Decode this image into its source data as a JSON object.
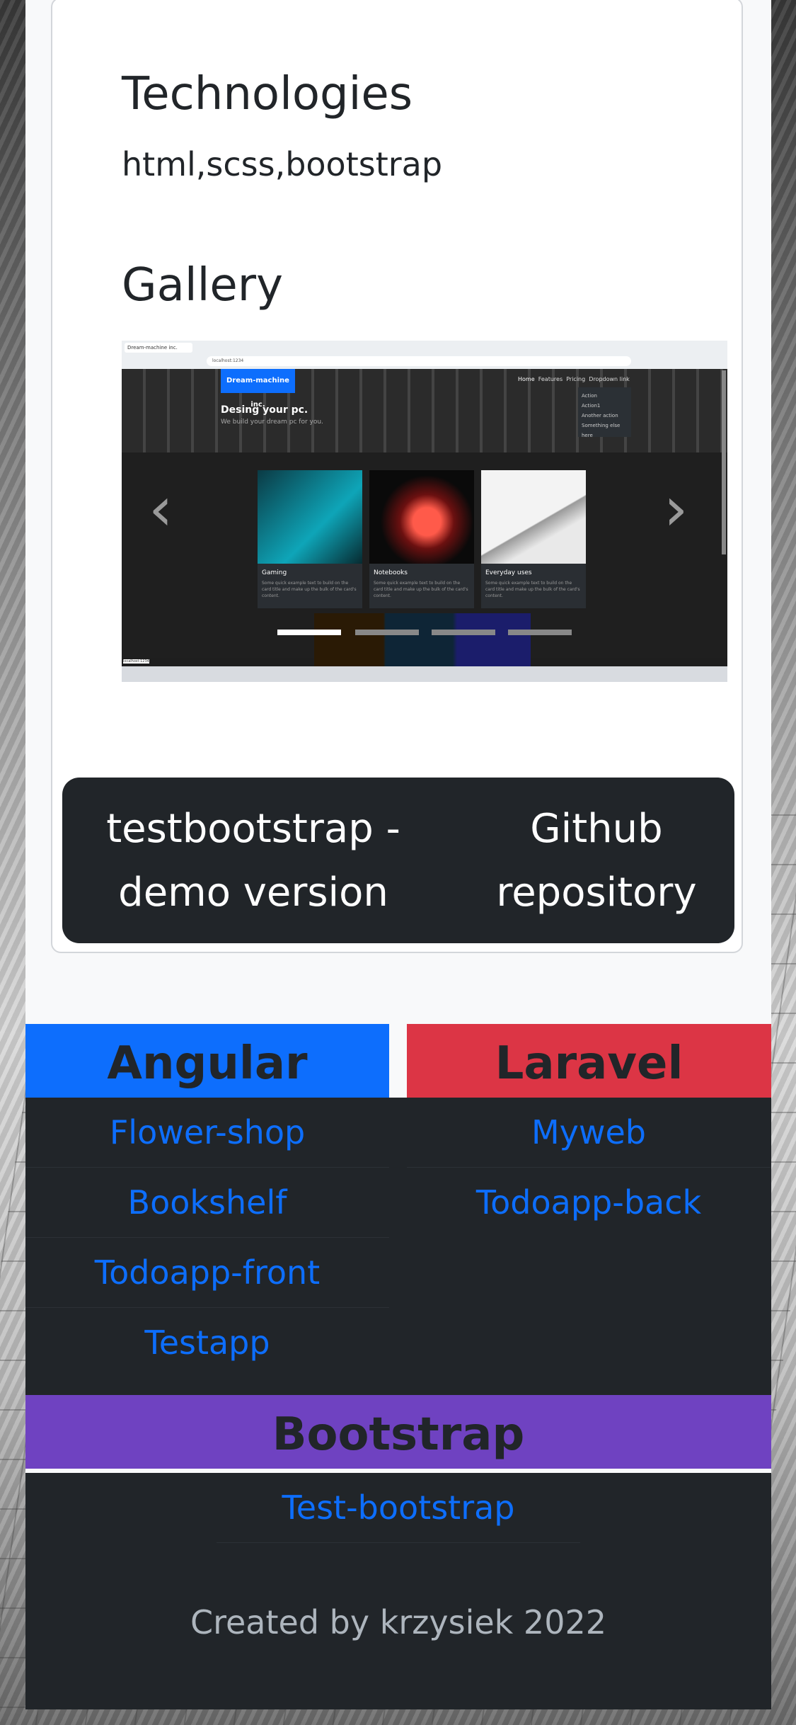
{
  "project": {
    "technologies_heading": "Technologies",
    "technologies_text": "html,scss,bootstrap",
    "gallery_heading": "Gallery",
    "gallery_image": {
      "tab_title": "Dream-machine inc.",
      "url": "localhost:1234",
      "brand": "Dream-machine inc.",
      "nav": [
        "Home",
        "Features",
        "Pricing",
        "Dropdown link"
      ],
      "dropdown": [
        "Action",
        "Action1",
        "Another action",
        "Something else here"
      ],
      "hero_title": "Desing your pc.",
      "hero_subtitle": "We build your dream pc for you.",
      "cards": [
        {
          "title": "Gaming",
          "text": "Some quick example text to build on the card title and make up the bulk of the card's content."
        },
        {
          "title": "Notebooks",
          "text": "Some quick example text to build on the card title and make up the bulk of the card's content."
        },
        {
          "title": "Everyday uses",
          "text": "Some quick example text to build on the card title and make up the bulk of the card's content."
        }
      ],
      "status": "localhost:1234",
      "arrow_prev": "‹",
      "arrow_next": "›"
    },
    "demo_button": [
      "testbootstrap -",
      "demo version"
    ],
    "github_button": [
      "Github",
      "repository"
    ]
  },
  "columns": {
    "angular": {
      "heading": "Angular",
      "color": "#0d6efd",
      "items": [
        "Flower-shop",
        "Bookshelf",
        "Todoapp-front",
        "Testapp"
      ]
    },
    "laravel": {
      "heading": "Laravel",
      "color": "#dc3545",
      "items": [
        "Myweb",
        "Todoapp-back"
      ]
    },
    "bootstrap": {
      "heading": "Bootstrap",
      "color": "#6f42c1",
      "items": [
        "Test-bootstrap"
      ]
    }
  },
  "footer": {
    "text": "Created by krzysiek 2022"
  },
  "colors": {
    "dark": "#212529",
    "link": "#0d6efd",
    "muted": "#adb5bd"
  }
}
